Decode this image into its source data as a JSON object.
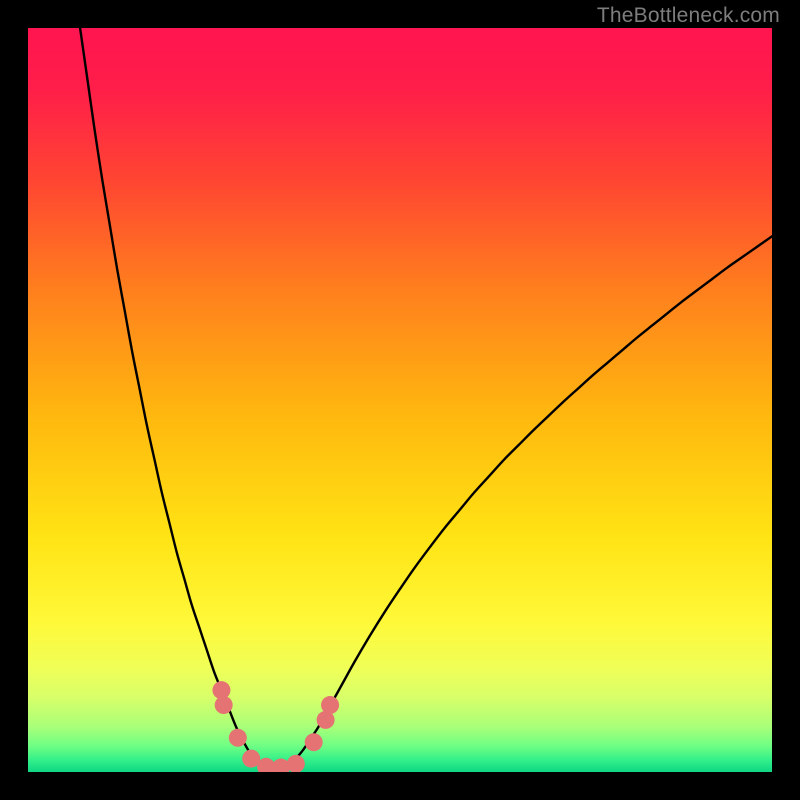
{
  "watermark": {
    "text": "TheBottleneck.com"
  },
  "chart_data": {
    "type": "line",
    "title": "",
    "xlabel": "",
    "ylabel": "",
    "xlim": [
      0,
      100
    ],
    "ylim": [
      0,
      100
    ],
    "x_min_at_valley": 32,
    "background_gradient": {
      "stops": [
        {
          "pos": 0.0,
          "color": "#ff1550"
        },
        {
          "pos": 0.08,
          "color": "#ff1e4a"
        },
        {
          "pos": 0.2,
          "color": "#ff4433"
        },
        {
          "pos": 0.35,
          "color": "#ff7f1e"
        },
        {
          "pos": 0.52,
          "color": "#ffb80f"
        },
        {
          "pos": 0.68,
          "color": "#ffe314"
        },
        {
          "pos": 0.8,
          "color": "#fff93a"
        },
        {
          "pos": 0.86,
          "color": "#f0ff58"
        },
        {
          "pos": 0.9,
          "color": "#d8ff6a"
        },
        {
          "pos": 0.94,
          "color": "#a8ff7a"
        },
        {
          "pos": 0.965,
          "color": "#6fff84"
        },
        {
          "pos": 0.985,
          "color": "#30ef8a"
        },
        {
          "pos": 1.0,
          "color": "#10d684"
        }
      ]
    },
    "curve": {
      "description": "V-shaped bottleneck curve with valley around x≈32 reaching y≈0; left arm rises steeply to y≈100 at x≈7; right arm rises to y≈72 at x=100.",
      "points": [
        {
          "x": 7.0,
          "y": 100.0
        },
        {
          "x": 8.0,
          "y": 93.0
        },
        {
          "x": 9.0,
          "y": 86.0
        },
        {
          "x": 10.0,
          "y": 79.5
        },
        {
          "x": 11.0,
          "y": 73.5
        },
        {
          "x": 12.0,
          "y": 67.5
        },
        {
          "x": 13.0,
          "y": 62.0
        },
        {
          "x": 14.0,
          "y": 56.5
        },
        {
          "x": 15.0,
          "y": 51.5
        },
        {
          "x": 16.0,
          "y": 46.5
        },
        {
          "x": 17.0,
          "y": 42.0
        },
        {
          "x": 18.0,
          "y": 37.5
        },
        {
          "x": 19.0,
          "y": 33.5
        },
        {
          "x": 20.0,
          "y": 29.5
        },
        {
          "x": 21.0,
          "y": 26.0
        },
        {
          "x": 22.0,
          "y": 22.5
        },
        {
          "x": 23.0,
          "y": 19.5
        },
        {
          "x": 24.0,
          "y": 16.5
        },
        {
          "x": 25.0,
          "y": 13.5
        },
        {
          "x": 26.0,
          "y": 11.0
        },
        {
          "x": 27.0,
          "y": 8.5
        },
        {
          "x": 28.0,
          "y": 6.0
        },
        {
          "x": 29.0,
          "y": 4.0
        },
        {
          "x": 30.0,
          "y": 2.3
        },
        {
          "x": 31.0,
          "y": 1.0
        },
        {
          "x": 32.0,
          "y": 0.3
        },
        {
          "x": 33.0,
          "y": 0.0
        },
        {
          "x": 34.0,
          "y": 0.2
        },
        {
          "x": 35.0,
          "y": 0.8
        },
        {
          "x": 36.0,
          "y": 1.8
        },
        {
          "x": 37.0,
          "y": 3.0
        },
        {
          "x": 38.0,
          "y": 4.5
        },
        {
          "x": 39.0,
          "y": 6.0
        },
        {
          "x": 40.0,
          "y": 7.8
        },
        {
          "x": 42.0,
          "y": 11.4
        },
        {
          "x": 44.0,
          "y": 15.0
        },
        {
          "x": 46.0,
          "y": 18.4
        },
        {
          "x": 48.0,
          "y": 21.6
        },
        {
          "x": 50.0,
          "y": 24.6
        },
        {
          "x": 52.0,
          "y": 27.5
        },
        {
          "x": 54.0,
          "y": 30.2
        },
        {
          "x": 56.0,
          "y": 32.8
        },
        {
          "x": 58.0,
          "y": 35.2
        },
        {
          "x": 60.0,
          "y": 37.6
        },
        {
          "x": 62.0,
          "y": 39.8
        },
        {
          "x": 64.0,
          "y": 42.0
        },
        {
          "x": 66.0,
          "y": 44.0
        },
        {
          "x": 68.0,
          "y": 46.0
        },
        {
          "x": 70.0,
          "y": 47.9
        },
        {
          "x": 72.0,
          "y": 49.8
        },
        {
          "x": 74.0,
          "y": 51.6
        },
        {
          "x": 76.0,
          "y": 53.4
        },
        {
          "x": 78.0,
          "y": 55.1
        },
        {
          "x": 80.0,
          "y": 56.8
        },
        {
          "x": 82.0,
          "y": 58.5
        },
        {
          "x": 84.0,
          "y": 60.1
        },
        {
          "x": 86.0,
          "y": 61.7
        },
        {
          "x": 88.0,
          "y": 63.3
        },
        {
          "x": 90.0,
          "y": 64.8
        },
        {
          "x": 92.0,
          "y": 66.3
        },
        {
          "x": 94.0,
          "y": 67.8
        },
        {
          "x": 96.0,
          "y": 69.2
        },
        {
          "x": 98.0,
          "y": 70.6
        },
        {
          "x": 100.0,
          "y": 72.0
        }
      ]
    },
    "markers": {
      "color": "#e57373",
      "radius": 9,
      "points": [
        {
          "x": 26.0,
          "y": 11.0
        },
        {
          "x": 26.3,
          "y": 9.0
        },
        {
          "x": 28.2,
          "y": 4.6
        },
        {
          "x": 30.0,
          "y": 1.8
        },
        {
          "x": 32.0,
          "y": 0.7
        },
        {
          "x": 34.0,
          "y": 0.6
        },
        {
          "x": 36.0,
          "y": 1.1
        },
        {
          "x": 38.4,
          "y": 4.0
        },
        {
          "x": 40.0,
          "y": 7.0
        },
        {
          "x": 40.6,
          "y": 9.0
        }
      ]
    }
  }
}
